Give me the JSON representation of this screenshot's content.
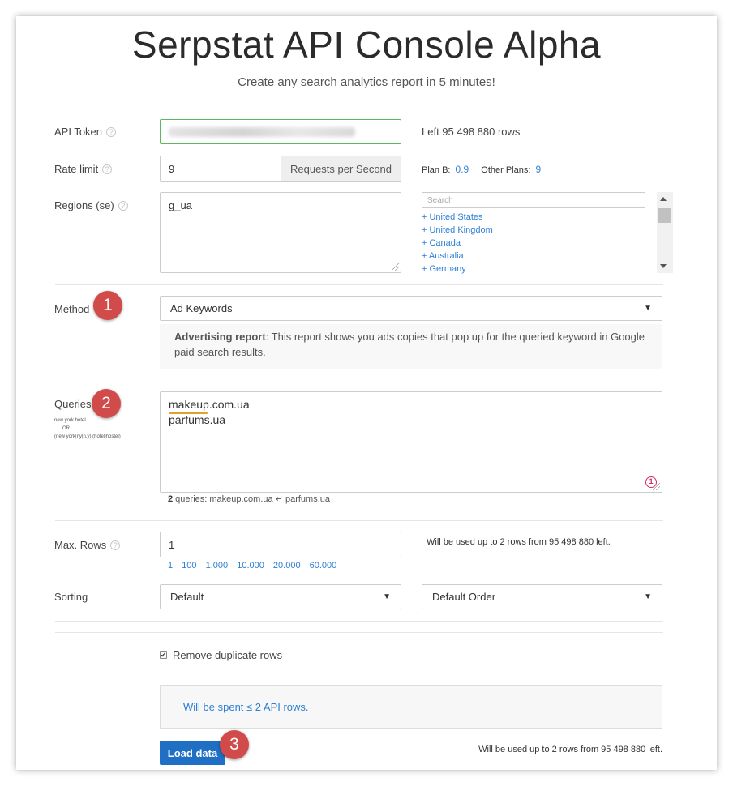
{
  "header": {
    "title": "Serpstat API Console Alpha",
    "subtitle": "Create any search analytics report in 5 minutes!"
  },
  "api_token": {
    "label": "API Token",
    "help": "?",
    "left_rows": "Left 95 498 880 rows"
  },
  "rate_limit": {
    "label": "Rate limit",
    "help": "?",
    "value": "9",
    "addon": "Requests per Second",
    "plan_b_label": "Plan B:",
    "plan_b_value": "0.9",
    "other_plans_label": "Other Plans:",
    "other_plans_value": "9"
  },
  "regions": {
    "label": "Regions (se)",
    "help": "?",
    "value": "g_ua",
    "search_placeholder": "Search",
    "items": [
      "+ United States",
      "+ United Kingdom",
      "+ Canada",
      "+ Australia",
      "+ Germany"
    ]
  },
  "method": {
    "label": "Method",
    "badge": "1",
    "selected": "Ad Keywords",
    "caret": "▼",
    "info_bold": "Advertising report",
    "info_text": ": This report shows you ads copies that pop up for the queried keyword in Google paid search results."
  },
  "queries": {
    "label": "Queries",
    "badge": "2",
    "hint_line1": "new york hotel",
    "hint_line2": "OR",
    "hint_line3": "(new york|ny|n.y) (hotel|hostel)",
    "lines": [
      "makeup.com.ua",
      "parfums.ua"
    ],
    "grammar_count": "1",
    "summary_count": "2",
    "summary_text": " queries: makeup.com.ua ↵ parfums.ua"
  },
  "max_rows": {
    "label": "Max. Rows",
    "help": "?",
    "value": "1",
    "note": "Will be used up to 2 rows from 95 498 880 left.",
    "quick_values": [
      "1",
      "100",
      "1.000",
      "10.000",
      "20.000",
      "60.000"
    ]
  },
  "sorting": {
    "label": "Sorting",
    "field_selected": "Default",
    "order_selected": "Default Order",
    "caret": "▼"
  },
  "options": {
    "remove_duplicates_label": "Remove duplicate rows",
    "remove_duplicates_checked": true,
    "check_glyph": "✔"
  },
  "footer": {
    "spent_text": "Will be spent ≤ 2 API rows.",
    "load_button": "Load data",
    "badge": "3",
    "note": "Will be used up to 2 rows from 95 498 880 left."
  }
}
